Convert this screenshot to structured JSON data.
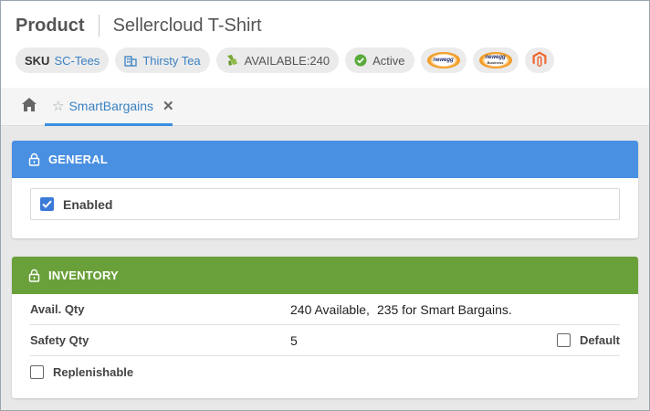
{
  "header": {
    "title": "Product",
    "product_name": "Sellercloud T-Shirt",
    "chips": {
      "sku_key": "SKU",
      "sku_value": "SC-Tees",
      "company": "Thirsty Tea",
      "available": "AVAILABLE:240",
      "status": "Active"
    },
    "logos": [
      "newegg-logo",
      "newegg-business-logo",
      "magento-logo"
    ],
    "newegg_text": "newegg",
    "newegg_business_text": "Business"
  },
  "tabs": {
    "active_label": "SmartBargains"
  },
  "general": {
    "title": "GENERAL",
    "enabled_label": "Enabled",
    "enabled_checked": true,
    "color": "#4a90e2"
  },
  "inventory": {
    "title": "INVENTORY",
    "color": "#6aa03a",
    "avail_label": "Avail. Qty",
    "avail_value_1": "240 Available,",
    "avail_value_2": "235 for Smart Bargains.",
    "safety_label": "Safety Qty",
    "safety_value": "5",
    "default_label": "Default",
    "default_checked": false,
    "replenishable_label": "Replenishable",
    "replenishable_checked": false
  }
}
